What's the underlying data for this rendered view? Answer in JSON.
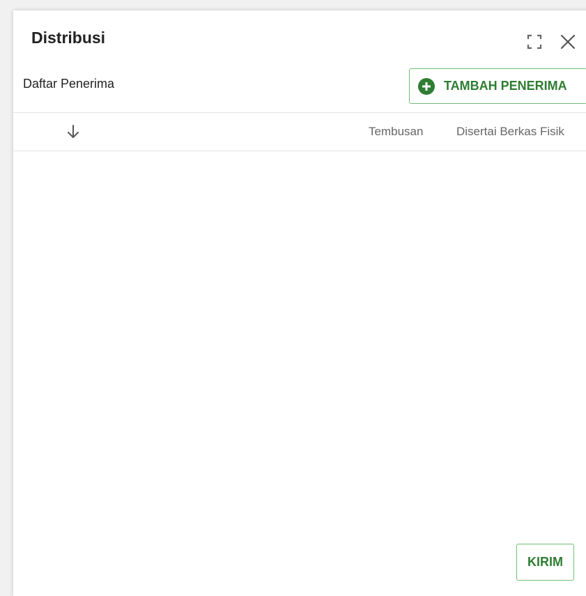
{
  "dialog": {
    "title": "Distribusi",
    "maximize_icon": "maximize-icon",
    "close_icon": "close-icon"
  },
  "recipients": {
    "label": "Daftar Penerima",
    "add_button": {
      "icon": "plus-circle-icon",
      "label": "TAMBAH PENERIMA"
    },
    "table": {
      "sort_icon": "arrow-down-icon",
      "columns": [
        "Tembusan",
        "Disertai Berkas Fisik"
      ],
      "rows": []
    }
  },
  "footer": {
    "send_label": "KIRIM"
  },
  "colors": {
    "accent": "#2e7d32",
    "button_border": "#6fbf73",
    "text": "#222222",
    "muted_text": "#666666"
  }
}
